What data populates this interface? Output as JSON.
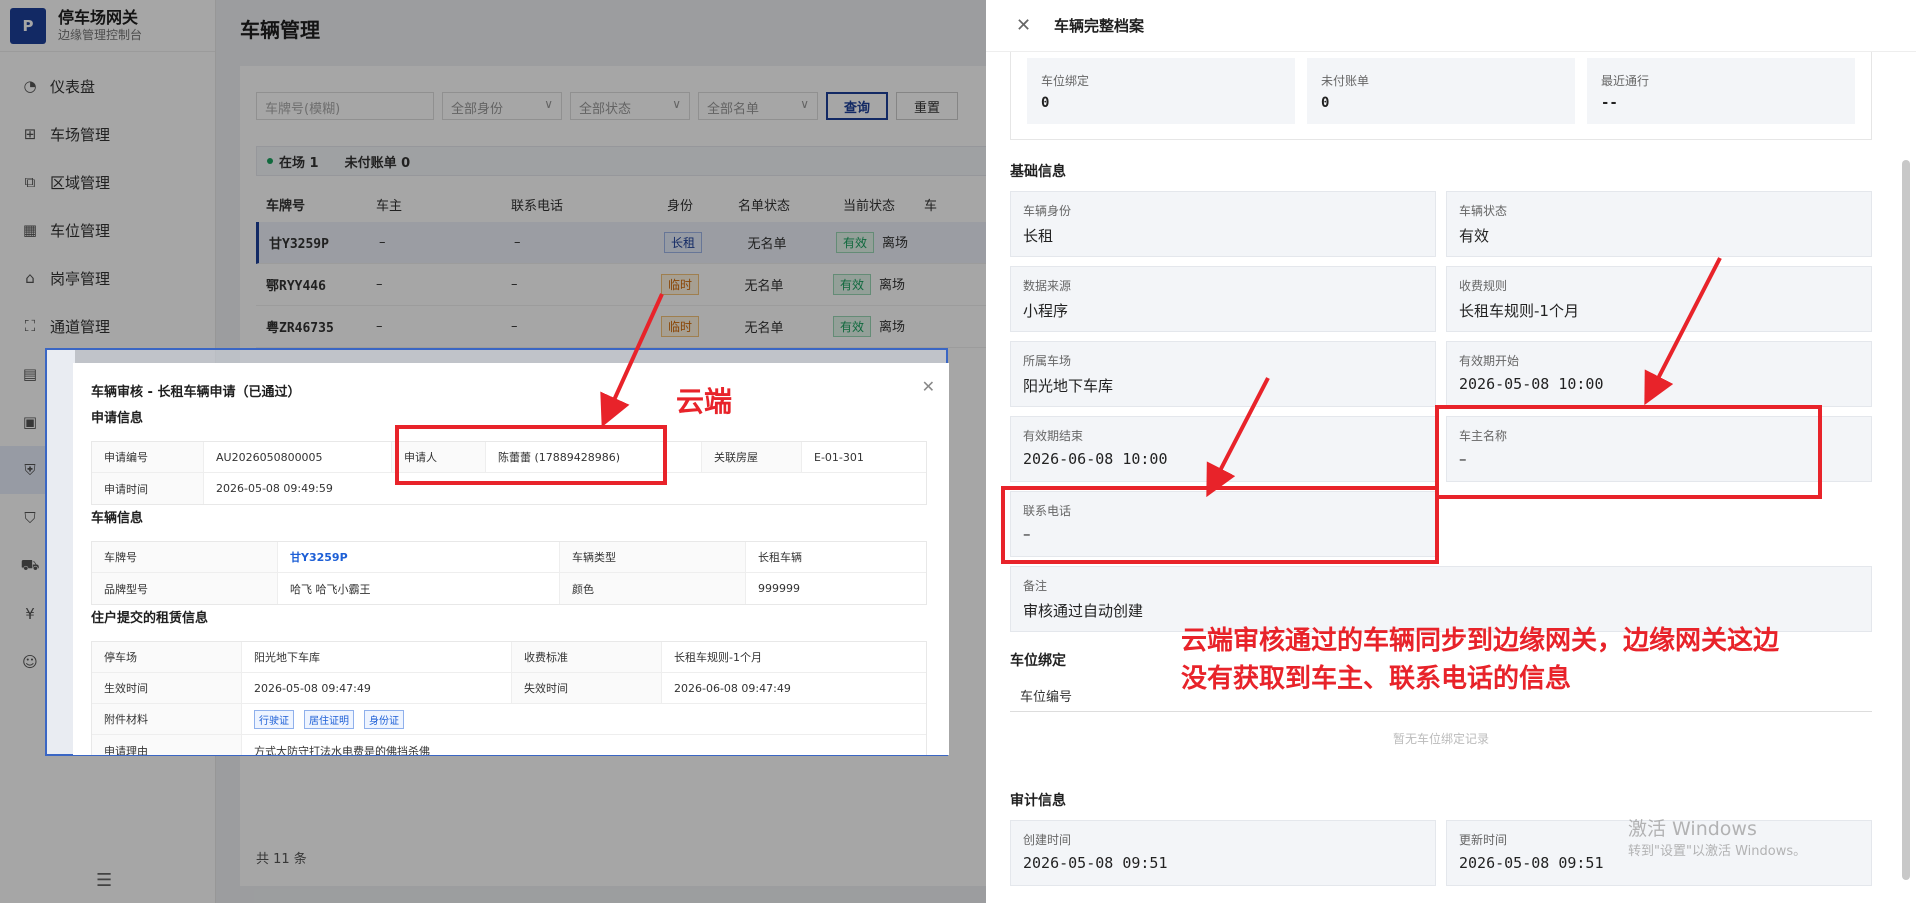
{
  "brand": {
    "logo": "P",
    "title": "停车场网关",
    "subtitle": "边缘管理控制台"
  },
  "sidebar": {
    "items": [
      {
        "label": "仪表盘",
        "icon": "dashboard-icon"
      },
      {
        "label": "车场管理",
        "icon": "grid-icon"
      },
      {
        "label": "区域管理",
        "icon": "area-icon"
      },
      {
        "label": "车位管理",
        "icon": "table-icon"
      },
      {
        "label": "岗亭管理",
        "icon": "bank-icon"
      },
      {
        "label": "通道管理",
        "icon": "channel-icon"
      }
    ],
    "collapse_icon": "menu-fold-icon"
  },
  "page": {
    "title": "车辆管理"
  },
  "filters": {
    "plate_placeholder": "车牌号(模糊)",
    "identity": "全部身份",
    "status": "全部状态",
    "list": "全部名单",
    "query": "查询",
    "reset": "重置"
  },
  "stats": {
    "in_lot": "在场 1",
    "unpaid": "未付账单 0"
  },
  "table": {
    "headers": [
      "车牌号",
      "车主",
      "联系电话",
      "身份",
      "名单状态",
      "当前状态",
      "车"
    ],
    "rows": [
      {
        "plate": "甘Y3259P",
        "owner": "–",
        "phone": "–",
        "identity": "长租",
        "list": "无名单",
        "valid": "有效",
        "presence": "离场"
      },
      {
        "plate": "鄂RYY446",
        "owner": "–",
        "phone": "–",
        "identity": "临时",
        "list": "无名单",
        "valid": "有效",
        "presence": "离场"
      },
      {
        "plate": "粤ZR46735",
        "owner": "–",
        "phone": "–",
        "identity": "临时",
        "list": "无名单",
        "valid": "有效",
        "presence": "离场"
      }
    ],
    "total": "共 11 条"
  },
  "dialog": {
    "title": "车辆审核 - 长租车辆申请（已通过）",
    "sec_apply": "申请信息",
    "apply_no_k": "申请编号",
    "apply_no_v": "AU2026050800005",
    "applicant_k": "申请人",
    "applicant_v": "陈蕾蕾 (17889428986)",
    "house_k": "关联房屋",
    "house_v": "E-01-301",
    "apply_time_k": "申请时间",
    "apply_time_v": "2026-05-08 09:49:59",
    "sec_vehicle": "车辆信息",
    "plate_k": "车牌号",
    "plate_v": "甘Y3259P",
    "type_k": "车辆类型",
    "type_v": "长租车辆",
    "brand_k": "品牌型号",
    "brand_v": "哈飞 哈飞小霸王",
    "color_k": "颜色",
    "color_v": "999999",
    "sec_lease": "住户提交的租赁信息",
    "lot_k": "停车场",
    "lot_v": "阳光地下车库",
    "fee_k": "收费标准",
    "fee_v": "长租车规则-1个月",
    "start_k": "生效时间",
    "start_v": "2026-05-08 09:47:49",
    "end_k": "失效时间",
    "end_v": "2026-06-08 09:47:49",
    "attach_k": "附件材料",
    "attach": [
      "行驶证",
      "居住证明",
      "身份证"
    ],
    "reason_k": "申请理由",
    "reason_v": "方式大防守打法水电费是的佛挡杀佛"
  },
  "annotations": {
    "cloud": "云端",
    "note_line1": "云端审核通过的车辆同步到边缘网关，边缘网关这边",
    "note_line2": "没有获取到车主、联系电话的信息",
    "color": "#e8232a"
  },
  "drawer": {
    "title": "车辆完整档案",
    "summary": [
      {
        "k": "车位绑定",
        "v": "0"
      },
      {
        "k": "未付账单",
        "v": "0"
      },
      {
        "k": "最近通行",
        "v": "--"
      }
    ],
    "sec_basic": "基础信息",
    "fields": [
      {
        "k": "车辆身份",
        "v": "长租"
      },
      {
        "k": "车辆状态",
        "v": "有效"
      },
      {
        "k": "数据来源",
        "v": "小程序"
      },
      {
        "k": "收费规则",
        "v": "长租车规则-1个月"
      },
      {
        "k": "所属车场",
        "v": "阳光地下车库"
      },
      {
        "k": "有效期开始",
        "v": "2026-05-08 10:00"
      },
      {
        "k": "有效期结束",
        "v": "2026-06-08 10:00"
      },
      {
        "k": "车主名称",
        "v": "–"
      },
      {
        "k": "联系电话",
        "v": "–"
      },
      {
        "k": "备注",
        "v": "审核通过自动创建"
      }
    ],
    "sec_bind": "车位绑定",
    "bind_col": "车位编号",
    "bind_empty": "暂无车位绑定记录",
    "sec_audit": "审计信息",
    "created_k": "创建时间",
    "created_v": "2026-05-08 09:51",
    "updated_k": "更新时间",
    "updated_v": "2026-05-08 09:51"
  },
  "watermark": {
    "line1": "激活 Windows",
    "line2": "转到\"设置\"以激活 Windows。"
  }
}
